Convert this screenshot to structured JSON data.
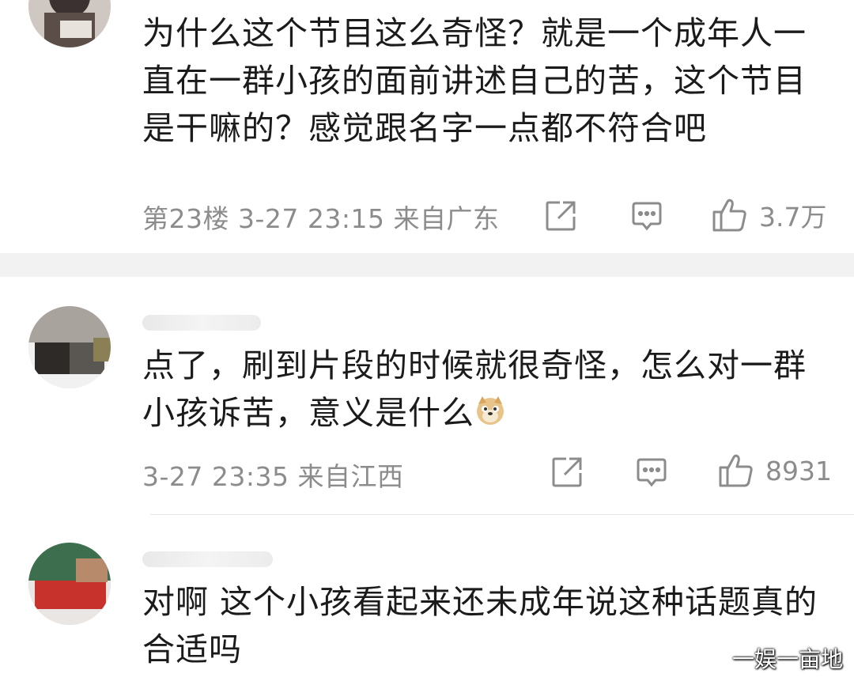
{
  "comments": [
    {
      "text": "为什么这个节目这么奇怪？就是一个成年人一直在一群小孩的面前讲述自己的苦，这个节目是干嘛的？感觉跟名字一点都不符合吧",
      "meta": "第23楼 3-27 23:15 来自广东",
      "likes": "3.7万"
    },
    {
      "text": "点了，刷到片段的时候就很奇怪，怎么对一群小孩诉苦，意义是什么",
      "emoji": "doge-emoji",
      "meta": "3-27 23:35 来自江西",
      "likes": "8931"
    },
    {
      "text": "对啊 这个小孩看起来还未成年说这种话题真的合适吗"
    }
  ],
  "icons": {
    "share": "share-icon",
    "reply": "comment-icon",
    "like": "thumbs-up-icon"
  },
  "colors": {
    "meta_text": "#8c8c8c",
    "body_text": "#1b1b1b",
    "separator": "#f2f2f2"
  },
  "watermark": "一娱一亩地"
}
